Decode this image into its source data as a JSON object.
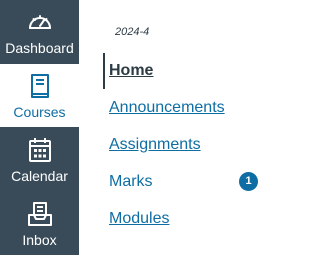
{
  "global_nav": {
    "items": [
      {
        "label": "Dashboard",
        "icon": "dashboard-gauge-icon"
      },
      {
        "label": "Courses",
        "icon": "courses-book-icon",
        "active": true
      },
      {
        "label": "Calendar",
        "icon": "calendar-icon"
      },
      {
        "label": "Inbox",
        "icon": "inbox-icon"
      }
    ]
  },
  "course_nav": {
    "term": "2024-4",
    "links": [
      {
        "label": "Home",
        "active": true
      },
      {
        "label": "Announcements"
      },
      {
        "label": "Assignments"
      },
      {
        "label": "Marks",
        "badge": "1"
      },
      {
        "label": "Modules"
      }
    ]
  },
  "colors": {
    "nav_background": "#394b58",
    "accent": "#0e6ea3",
    "text_dark": "#2d3b45"
  }
}
